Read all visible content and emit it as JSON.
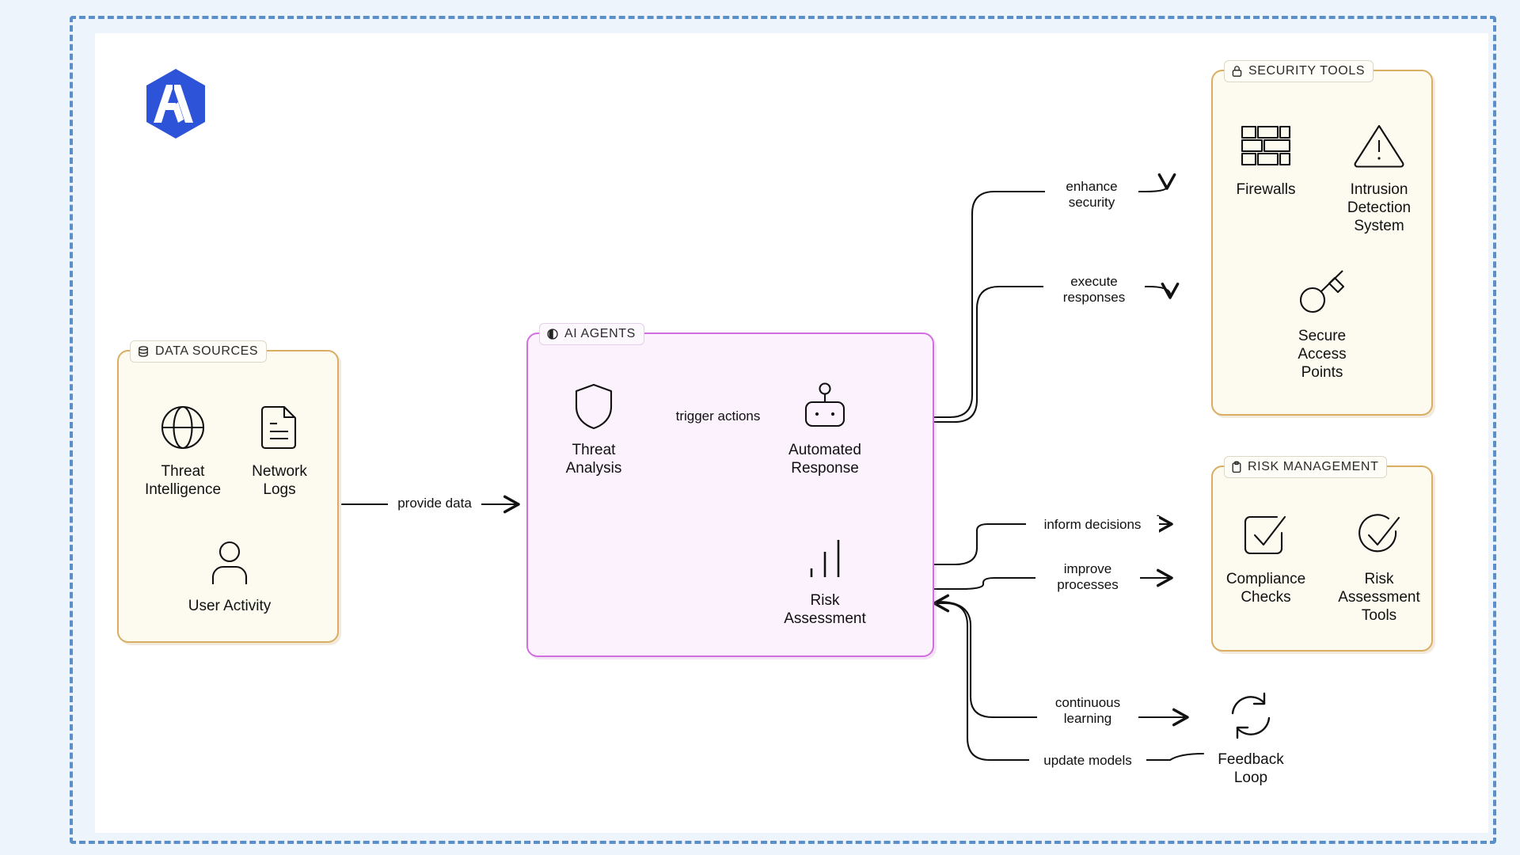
{
  "canvas": {
    "background": "#eef4fb",
    "sheet_background": "#ffffff",
    "frame_color": "#5b8fc9"
  },
  "logo": {
    "name": "brand-logo",
    "shape": "hexagon",
    "letter": "A",
    "fill": "#2d54d8"
  },
  "groups": {
    "data_sources": {
      "badge_label": "DATA SOURCES",
      "badge_icon": "database-icon",
      "accent": "#d9ad62",
      "fill": "#fdfaf0",
      "nodes": [
        {
          "id": "threat-intelligence",
          "label": "Threat\nIntelligence",
          "icon": "globe-icon"
        },
        {
          "id": "network-logs",
          "label": "Network\nLogs",
          "icon": "document-lines-icon"
        },
        {
          "id": "user-activity",
          "label": "User Activity",
          "icon": "user-icon"
        }
      ]
    },
    "ai_agents": {
      "badge_label": "AI AGENTS",
      "badge_icon": "brain-icon",
      "accent": "#d26fe0",
      "fill": "#fcf2fd",
      "nodes": [
        {
          "id": "threat-analysis",
          "label": "Threat\nAnalysis",
          "icon": "shield-icon"
        },
        {
          "id": "automated-response",
          "label": "Automated\nResponse",
          "icon": "robot-icon"
        },
        {
          "id": "risk-assessment",
          "label": "Risk\nAssessment",
          "icon": "bar-chart-icon"
        }
      ]
    },
    "security_tools": {
      "badge_label": "SECURITY TOOLS",
      "badge_icon": "lock-icon",
      "accent": "#d9ad62",
      "fill": "#fdfaf0",
      "nodes": [
        {
          "id": "firewalls",
          "label": "Firewalls",
          "icon": "brick-wall-icon"
        },
        {
          "id": "intrusion-detection-system",
          "label": "Intrusion\nDetection\nSystem",
          "icon": "warning-triangle-icon"
        },
        {
          "id": "secure-access-points",
          "label": "Secure\nAccess\nPoints",
          "icon": "key-icon"
        }
      ]
    },
    "risk_management": {
      "badge_label": "RISK MANAGEMENT",
      "badge_icon": "clipboard-icon",
      "accent": "#d9ad62",
      "fill": "#fdfaf0",
      "nodes": [
        {
          "id": "compliance-checks",
          "label": "Compliance\nChecks",
          "icon": "check-square-icon"
        },
        {
          "id": "risk-assessment-tools",
          "label": "Risk\nAssessment\nTools",
          "icon": "check-circle-icon"
        }
      ]
    }
  },
  "standalone_nodes": [
    {
      "id": "feedback-loop",
      "label": "Feedback\nLoop",
      "icon": "refresh-cycle-icon"
    }
  ],
  "edges": [
    {
      "id": "provide-data",
      "label": "provide data",
      "from": "data-sources",
      "to": "ai-agents"
    },
    {
      "id": "trigger-actions",
      "label": "trigger actions",
      "from": "threat-analysis",
      "to": "automated-response"
    },
    {
      "id": "enhance-security",
      "label": "enhance\nsecurity",
      "from": "automated-response",
      "to": "security-tools"
    },
    {
      "id": "execute-responses",
      "label": "execute\nresponses",
      "from": "automated-response",
      "to": "security-tools"
    },
    {
      "id": "inform-decisions",
      "label": "inform decisions",
      "from": "risk-assessment",
      "to": "risk-management"
    },
    {
      "id": "improve-processes",
      "label": "improve\nprocesses",
      "from": "risk-assessment",
      "to": "risk-management"
    },
    {
      "id": "continuous-learning",
      "label": "continuous\nlearning",
      "from": "risk-assessment",
      "to": "feedback-loop"
    },
    {
      "id": "update-models",
      "label": "update models",
      "from": "feedback-loop",
      "to": "risk-assessment"
    }
  ]
}
